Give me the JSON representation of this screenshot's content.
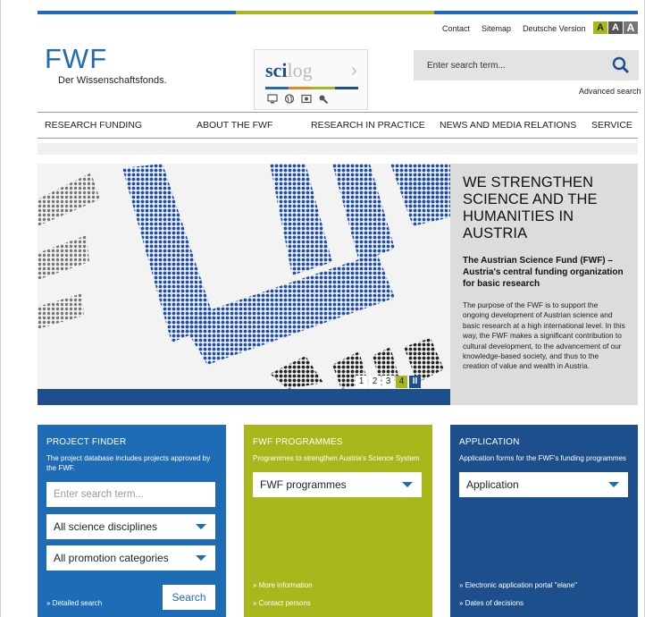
{
  "top_links": [
    "Contact",
    "Sitemap",
    "Deutsche Version"
  ],
  "font_size_buttons": [
    "A",
    "A",
    "A"
  ],
  "logo": {
    "mark": "FWF",
    "subtitle": "Der Wissenschaftsfonds."
  },
  "scilog": {
    "sci": "sci",
    "log": "log",
    "chevron": "›",
    "bar_colors": [
      "#1d6cb5",
      "#e88a1a",
      "#a8b81c",
      "#1d4f8c"
    ],
    "icons": [
      "monitor-icon",
      "globe-icon",
      "image-icon",
      "search-icon"
    ]
  },
  "search": {
    "placeholder": "Enter search term...",
    "advanced": "Advanced search"
  },
  "nav": [
    "RESEARCH FUNDING",
    "ABOUT THE FWF",
    "RESEARCH IN PRACTICE",
    "NEWS AND MEDIA RELATIONS",
    "SERVICE"
  ],
  "hero": {
    "title": "WE STRENGTHEN SCIENCE AND THE HUMANITIES IN AUSTRIA",
    "subtitle": "The Austrian Science Fund (FWF) – Austria's central funding organization for basic research",
    "body": "The purpose of the FWF is to support the ongoing development of Austrian science and basic research at a high international level. In this way, the FWF makes a significant contribution to cultural development, to the advancement of our knowledge-based society, and thus to the creation of value and wealth in Austria.",
    "pager": [
      "1",
      "2",
      "3",
      "4"
    ],
    "active_page": "4",
    "pause": "II"
  },
  "project_finder": {
    "title": "PROJECT FINDER",
    "desc": "The project database includes projects approved by the FWF.",
    "placeholder": "Enter search term...",
    "select1": "All science disciplines",
    "select2": "All promotion categories",
    "link": "» Detailed search",
    "button": "Search"
  },
  "programmes": {
    "title": "FWF PROGRAMMES",
    "desc": "Programmes to strengthen Austria's Science System",
    "select": "FWF programmes",
    "links": [
      "» More information",
      "» Contact persons"
    ]
  },
  "application": {
    "title": "APPLICATION",
    "desc": "Application forms for the FWF's funding programmes",
    "select": "Application",
    "links": [
      "» Electronic application portal \"elane\"",
      "» Dates of decisions"
    ]
  },
  "colors": {
    "blue": "#1d6cb5",
    "navy": "#1d4f8c",
    "green": "#a8b81c",
    "grey": "#dcdcdc"
  }
}
